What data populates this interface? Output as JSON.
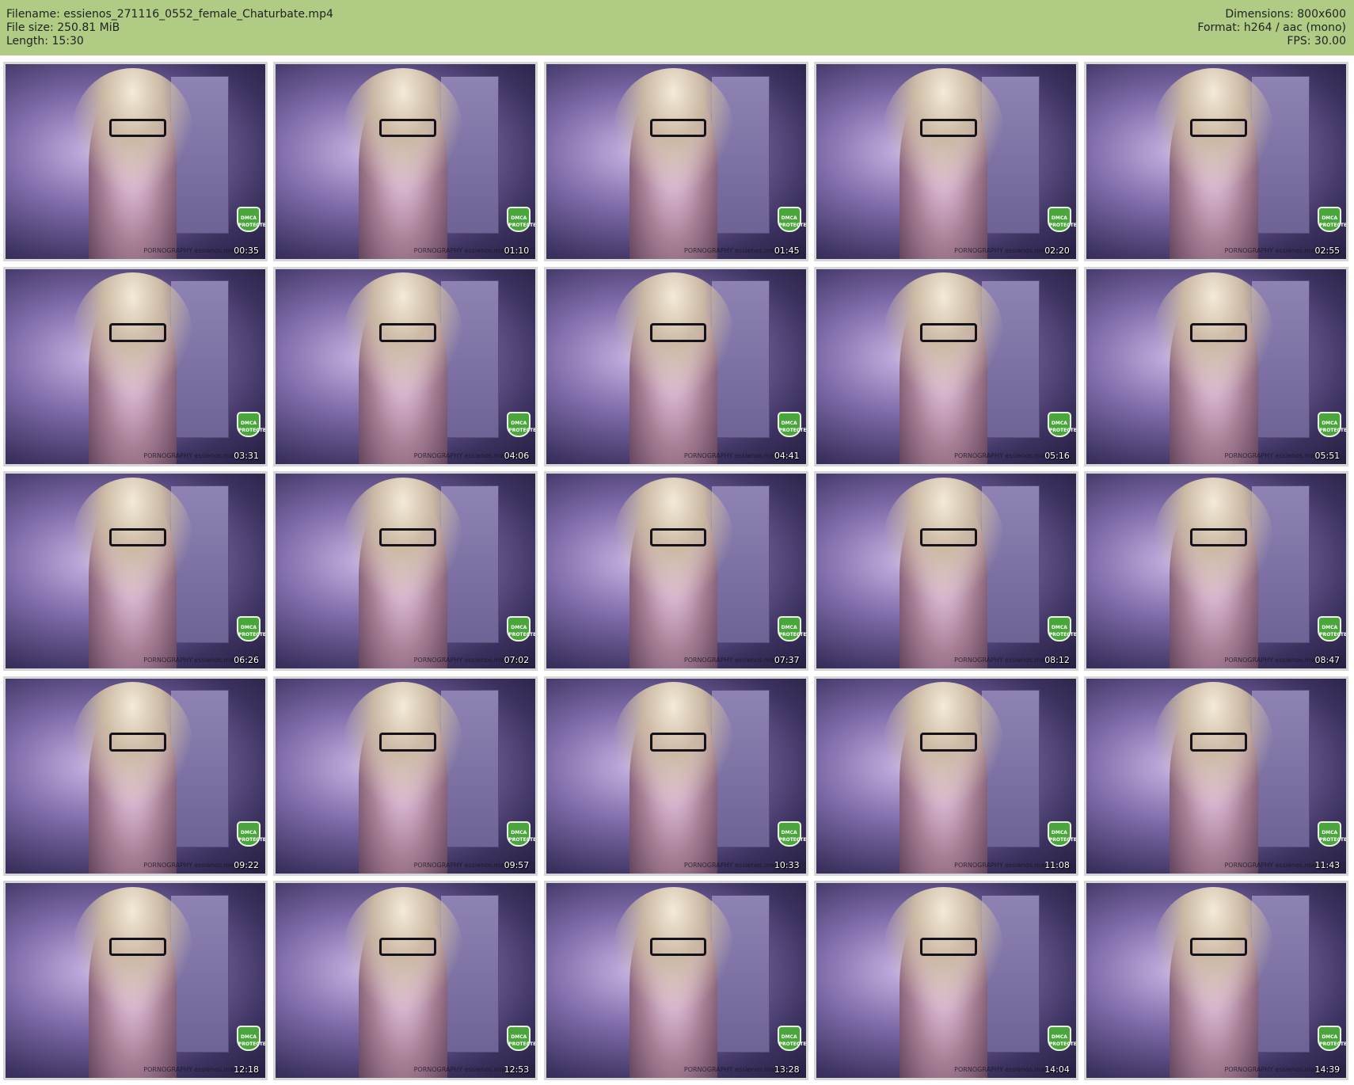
{
  "header": {
    "filename_line": "Filename: essienos_271116_0552_female_Chaturbate.mp4",
    "filesize_line": "File size: 250.81 MiB",
    "length_line": "Length: 15:30",
    "dimensions_line": "Dimensions: 800x600",
    "format_line": "Format: h264 / aac (mono)",
    "fps_line": "FPS: 30.00"
  },
  "colors": {
    "header_bg": "#b0cc84",
    "frame_tint": "#7d6aa8",
    "badge_green": "#4aa63c"
  },
  "badge_label": "DMCA PROTECTED",
  "watermark": "PORNOGRAPHY essienos.many",
  "thumbnails": [
    {
      "time": "00:35"
    },
    {
      "time": "01:10"
    },
    {
      "time": "01:45"
    },
    {
      "time": "02:20"
    },
    {
      "time": "02:55"
    },
    {
      "time": "03:31"
    },
    {
      "time": "04:06"
    },
    {
      "time": "04:41"
    },
    {
      "time": "05:16"
    },
    {
      "time": "05:51"
    },
    {
      "time": "06:26"
    },
    {
      "time": "07:02"
    },
    {
      "time": "07:37"
    },
    {
      "time": "08:12"
    },
    {
      "time": "08:47"
    },
    {
      "time": "09:22"
    },
    {
      "time": "09:57"
    },
    {
      "time": "10:33"
    },
    {
      "time": "11:08"
    },
    {
      "time": "11:43"
    },
    {
      "time": "12:18"
    },
    {
      "time": "12:53"
    },
    {
      "time": "13:28"
    },
    {
      "time": "14:04"
    },
    {
      "time": "14:39"
    }
  ]
}
